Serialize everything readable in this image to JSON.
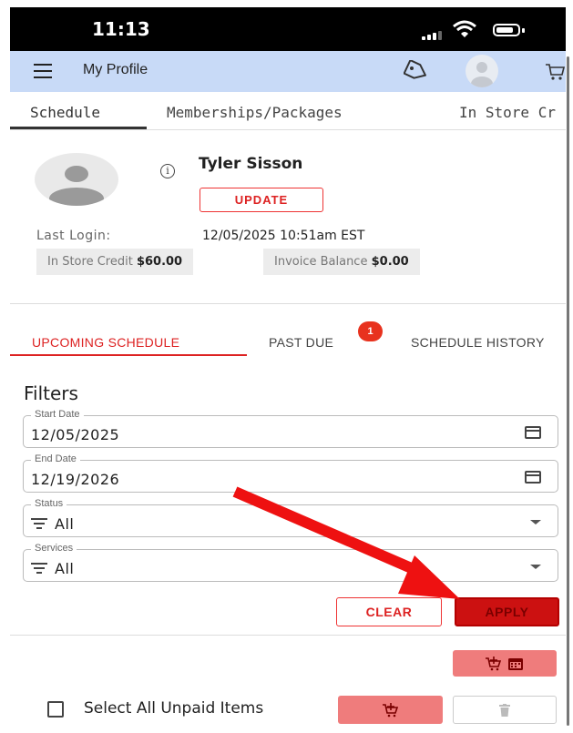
{
  "status_bar": {
    "time": "11:13"
  },
  "app_bar": {
    "title": "My Profile"
  },
  "top_tabs": [
    {
      "label": "Schedule"
    },
    {
      "label": "Memberships/Packages"
    },
    {
      "label": "In Store Cr"
    }
  ],
  "profile": {
    "name": "Tyler Sisson",
    "update_label": "UPDATE",
    "last_login_label": "Last Login:",
    "last_login_value": "12/05/2025 10:51am EST",
    "in_store_credit_label": "In Store Credit",
    "in_store_credit_value": "$60.00",
    "invoice_balance_label": "Invoice Balance",
    "invoice_balance_value": "$0.00"
  },
  "schedule_tabs": [
    {
      "label": "UPCOMING SCHEDULE"
    },
    {
      "label": "PAST DUE"
    },
    {
      "label": "SCHEDULE HISTORY"
    }
  ],
  "past_due_badge": "1",
  "filters": {
    "title": "Filters",
    "start_date_label": "Start Date",
    "start_date_value": "12/05/2025",
    "end_date_label": "End Date",
    "end_date_value": "12/19/2026",
    "status_label": "Status",
    "status_value": "All",
    "services_label": "Services",
    "services_value": "All",
    "clear_label": "CLEAR",
    "apply_label": "APPLY"
  },
  "select_all_label": "Select All Unpaid Items",
  "icons": {
    "menu": "menu-icon",
    "tag": "tag-icon",
    "cart": "cart-icon",
    "info": "info-icon",
    "calendar": "calendar-icon",
    "filter": "filter-list-icon",
    "trash": "trash-icon"
  },
  "colors": {
    "app_bar": "#c8daf7",
    "accent_red": "#d22222",
    "apply_bg": "#cc1111",
    "soft_red": "#ef7c7c",
    "annotation_arrow": "#ee1111"
  }
}
